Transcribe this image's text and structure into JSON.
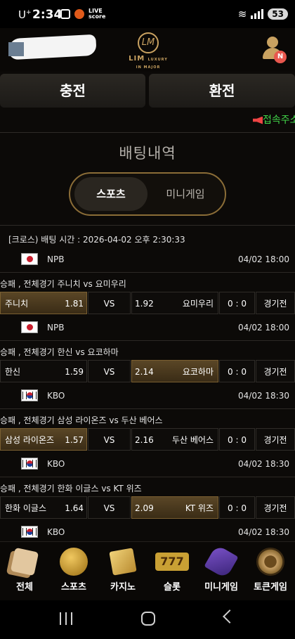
{
  "status_bar": {
    "carrier": "U",
    "carrier_sup": "+",
    "time": "2:34",
    "live_label": "LIVE",
    "live_sub": "score",
    "battery": "53"
  },
  "header": {
    "logo_mark": "LM",
    "logo_text": "LIM",
    "logo_small": "LUXURY IN MAJOR",
    "user_badge": "N"
  },
  "actions": {
    "deposit": "충전",
    "withdraw": "환전"
  },
  "notice": "접속주소",
  "page_title": "배팅내역",
  "tabs": {
    "sports": "스포츠",
    "minigame": "미니게임"
  },
  "bet": {
    "header": "[크로스) 배팅 시간 : 2026-04-02 오후 2:30:33"
  },
  "matches": [
    {
      "league_flag": "jp",
      "league": "NPB",
      "league_time": "04/02 18:00",
      "title": "승패 , 전체경기 주니치  vs  요미우리",
      "home": "주니치",
      "home_odds": "1.81",
      "vs": "VS",
      "away_odds": "1.92",
      "away": "요미우리",
      "score": "0 : 0",
      "status": "경기전",
      "pick": "home"
    },
    {
      "league_flag": "jp",
      "league": "NPB",
      "league_time": "04/02 18:00",
      "title": "승패 , 전체경기 한신  vs  요코하마",
      "home": "한신",
      "home_odds": "1.59",
      "vs": "VS",
      "away_odds": "2.14",
      "away": "요코하마",
      "score": "0 : 0",
      "status": "경기전",
      "pick": "away"
    },
    {
      "league_flag": "kr",
      "league": "KBO",
      "league_time": "04/02 18:30",
      "title": "승패 , 전체경기 삼성 라이온즈  vs  두산 베어스",
      "home": "삼성 라이온즈",
      "home_odds": "1.57",
      "vs": "VS",
      "away_odds": "2.16",
      "away": "두산 베어스",
      "score": "0 : 0",
      "status": "경기전",
      "pick": "home"
    },
    {
      "league_flag": "kr",
      "league": "KBO",
      "league_time": "04/02 18:30",
      "title": "승패 , 전체경기 한화 이글스  vs  KT 위즈",
      "home": "한화 이글스",
      "home_odds": "1.64",
      "vs": "VS",
      "away_odds": "2.09",
      "away": "KT 위즈",
      "score": "0 : 0",
      "status": "경기전",
      "pick": "away"
    }
  ],
  "last_league": {
    "league_flag": "kr",
    "league": "KBO",
    "league_time": "04/02 18:30"
  },
  "bottom_nav": [
    {
      "icon": "dice-icon",
      "label": "전체"
    },
    {
      "icon": "soccer-ball-icon",
      "label": "스포츠"
    },
    {
      "icon": "cards-icon",
      "label": "카지노"
    },
    {
      "icon": "slot-777-icon",
      "label": "슬롯",
      "icon_text": "777"
    },
    {
      "icon": "rocket-icon",
      "label": "미니게임"
    },
    {
      "icon": "roulette-icon",
      "label": "토큰게임"
    }
  ]
}
